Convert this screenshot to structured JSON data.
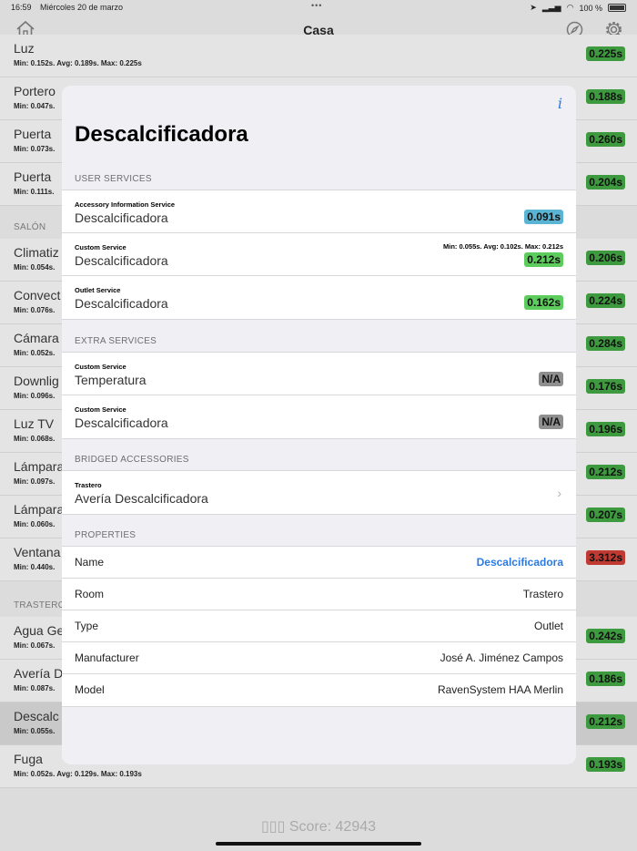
{
  "status_bar": {
    "time": "16:59",
    "date": "Miércoles 20 de marzo",
    "dots": "•••",
    "battery": "100 %"
  },
  "navbar": {
    "title": "Casa"
  },
  "background_list": {
    "rows": [
      {
        "name": "Luz",
        "stats": "Min: 0.152s. Avg: 0.189s. Max: 0.225s",
        "value": "0.225s",
        "color": "green"
      },
      {
        "name": "Portero",
        "stats": "Min: 0.047s.",
        "value": "0.188s",
        "color": "green"
      },
      {
        "name": "Puerta",
        "stats": "Min: 0.073s.",
        "value": "0.260s",
        "color": "green"
      },
      {
        "name": "Puerta",
        "stats": "Min: 0.111s.",
        "value": "0.204s",
        "color": "green"
      },
      {
        "name": "Climatiz",
        "stats": "Min: 0.054s.",
        "value": "0.206s",
        "color": "green"
      },
      {
        "name": "Convect",
        "stats": "Min: 0.076s.",
        "value": "0.224s",
        "color": "green"
      },
      {
        "name": "Cámara",
        "stats": "Min: 0.052s.",
        "value": "0.284s",
        "color": "green"
      },
      {
        "name": "Downlig",
        "stats": "Min: 0.096s.",
        "value": "0.176s",
        "color": "green"
      },
      {
        "name": "Luz TV",
        "stats": "Min: 0.068s.",
        "value": "0.196s",
        "color": "green"
      },
      {
        "name": "Lámpara",
        "stats": "Min: 0.097s.",
        "value": "0.212s",
        "color": "green"
      },
      {
        "name": "Lámpara",
        "stats": "Min: 0.060s.",
        "value": "0.207s",
        "color": "green"
      },
      {
        "name": "Ventana",
        "stats": "Min: 0.440s.",
        "value": "3.312s",
        "color": "red"
      },
      {
        "name": "Agua Ge",
        "stats": "Min: 0.067s.",
        "value": "0.242s",
        "color": "green"
      },
      {
        "name": "Avería D",
        "stats": "Min: 0.087s.",
        "value": "0.186s",
        "color": "green"
      },
      {
        "name": "Descalc",
        "stats": "Min: 0.055s.",
        "value": "0.212s",
        "color": "green"
      },
      {
        "name": "Fuga",
        "stats": "Min: 0.052s. Avg: 0.129s. Max: 0.193s",
        "value": "0.193s",
        "color": "green"
      }
    ],
    "headers": {
      "salon": "SALÓN",
      "trastero": "TRASTERO"
    }
  },
  "score": "Score: 42943",
  "modal": {
    "info_icon": "i",
    "title": "Descalcificadora",
    "user_services": {
      "header": "USER SERVICES",
      "items": [
        {
          "type": "Accessory Information Service",
          "name": "Descalcificadora",
          "badge": "0.091s",
          "badge_color": "blue",
          "stats": ""
        },
        {
          "type": "Custom Service",
          "name": "Descalcificadora",
          "badge": "0.212s",
          "badge_color": "green",
          "stats": "Min: 0.055s. Avg: 0.102s. Max: 0.212s"
        },
        {
          "type": "Outlet Service",
          "name": "Descalcificadora",
          "badge": "0.162s",
          "badge_color": "green",
          "stats": ""
        }
      ]
    },
    "extra_services": {
      "header": "EXTRA SERVICES",
      "items": [
        {
          "type": "Custom Service",
          "name": "Temperatura",
          "badge": "N/A",
          "badge_color": "gray"
        },
        {
          "type": "Custom Service",
          "name": "Descalcificadora",
          "badge": "N/A",
          "badge_color": "gray"
        }
      ]
    },
    "bridged_accessories": {
      "header": "BRIDGED ACCESSORIES",
      "items": [
        {
          "type": "Trastero",
          "name": "Avería Descalcificadora",
          "chevron": "›"
        }
      ]
    },
    "properties": {
      "header": "PROPERTIES",
      "items": [
        {
          "key": "Name",
          "value": "Descalcificadora",
          "link": true
        },
        {
          "key": "Room",
          "value": "Trastero"
        },
        {
          "key": "Type",
          "value": "Outlet"
        },
        {
          "key": "Manufacturer",
          "value": "José A. Jiménez Campos"
        },
        {
          "key": "Model",
          "value": "RavenSystem HAA Merlin"
        }
      ]
    }
  }
}
